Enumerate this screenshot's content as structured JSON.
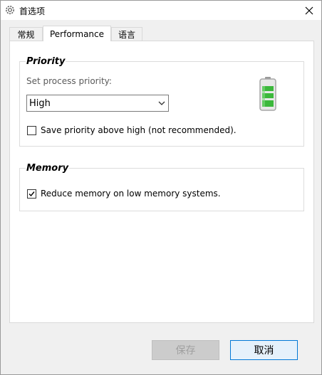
{
  "window": {
    "title": "首选项"
  },
  "tabs": [
    {
      "label": "常规",
      "active": false
    },
    {
      "label": "Performance",
      "active": true
    },
    {
      "label": "语言",
      "active": false
    }
  ],
  "priority": {
    "group_title": "Priority",
    "set_label": "Set process priority:",
    "selected": "High",
    "save_above_high_label": "Save priority above high (not recommended).",
    "save_above_high_checked": false
  },
  "memory": {
    "group_title": "Memory",
    "reduce_label": "Reduce memory on low memory systems.",
    "reduce_checked": true
  },
  "buttons": {
    "save": "保存",
    "cancel": "取消"
  },
  "colors": {
    "battery_fill": "#3cb83c",
    "accent": "#0078d7"
  },
  "icons": {
    "title": "gear-icon",
    "close": "close-icon",
    "battery": "battery-icon"
  }
}
